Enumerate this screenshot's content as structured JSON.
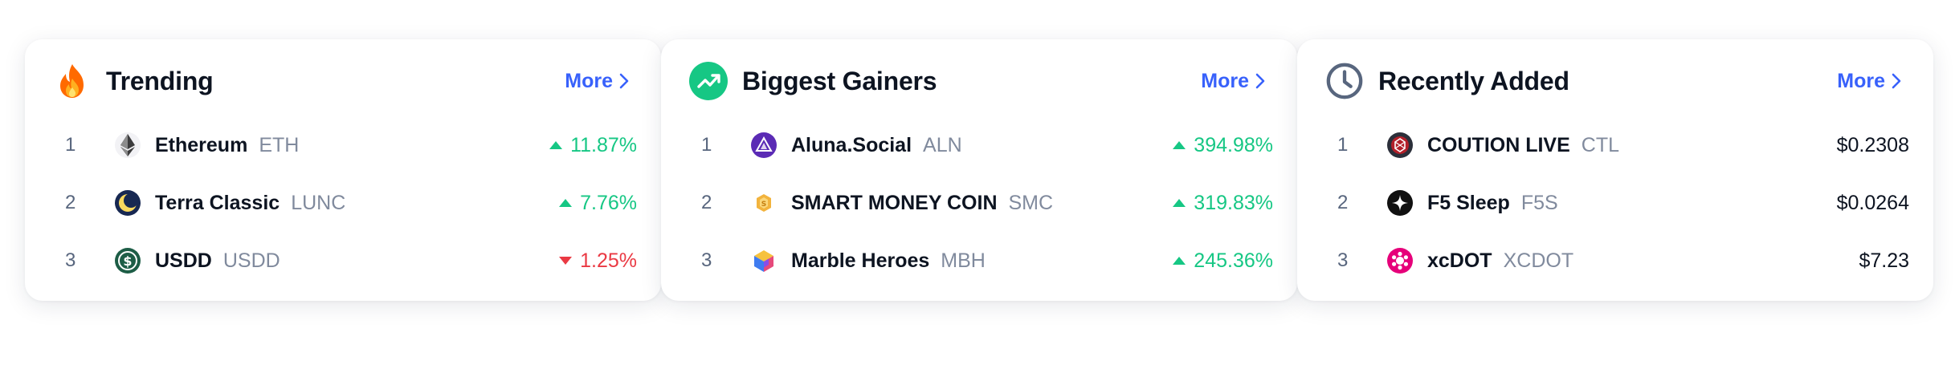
{
  "colors": {
    "accent": "#3861fb",
    "up": "#16c784",
    "down": "#ea3943",
    "text": "#0d1421",
    "muted": "#808a9d"
  },
  "cards": [
    {
      "title": "Trending",
      "icon": "fire-icon",
      "more_label": "More",
      "rows": [
        {
          "rank": "1",
          "name": "Ethereum",
          "symbol": "ETH",
          "change": "11.87%",
          "direction": "up",
          "logo": "ethereum-logo"
        },
        {
          "rank": "2",
          "name": "Terra Classic",
          "symbol": "LUNC",
          "change": "7.76%",
          "direction": "up",
          "logo": "terra-classic-logo"
        },
        {
          "rank": "3",
          "name": "USDD",
          "symbol": "USDD",
          "change": "1.25%",
          "direction": "down",
          "logo": "usdd-logo"
        }
      ]
    },
    {
      "title": "Biggest Gainers",
      "icon": "trending-up-icon",
      "more_label": "More",
      "rows": [
        {
          "rank": "1",
          "name": "Aluna.Social",
          "symbol": "ALN",
          "change": "394.98%",
          "direction": "up",
          "logo": "aluna-social-logo"
        },
        {
          "rank": "2",
          "name": "SMART MONEY COIN",
          "symbol": "SMC",
          "change": "319.83%",
          "direction": "up",
          "logo": "smart-money-coin-logo"
        },
        {
          "rank": "3",
          "name": "Marble Heroes",
          "symbol": "MBH",
          "change": "245.36%",
          "direction": "up",
          "logo": "marble-heroes-logo"
        }
      ]
    },
    {
      "title": "Recently Added",
      "icon": "clock-icon",
      "more_label": "More",
      "rows": [
        {
          "rank": "1",
          "name": "COUTION LIVE",
          "symbol": "CTL",
          "price": "$0.2308",
          "logo": "coution-live-logo"
        },
        {
          "rank": "2",
          "name": "F5 Sleep",
          "symbol": "F5S",
          "price": "$0.0264",
          "logo": "f5-sleep-logo"
        },
        {
          "rank": "3",
          "name": "xcDOT",
          "symbol": "XCDOT",
          "price": "$7.23",
          "logo": "xcdot-logo"
        }
      ]
    }
  ]
}
